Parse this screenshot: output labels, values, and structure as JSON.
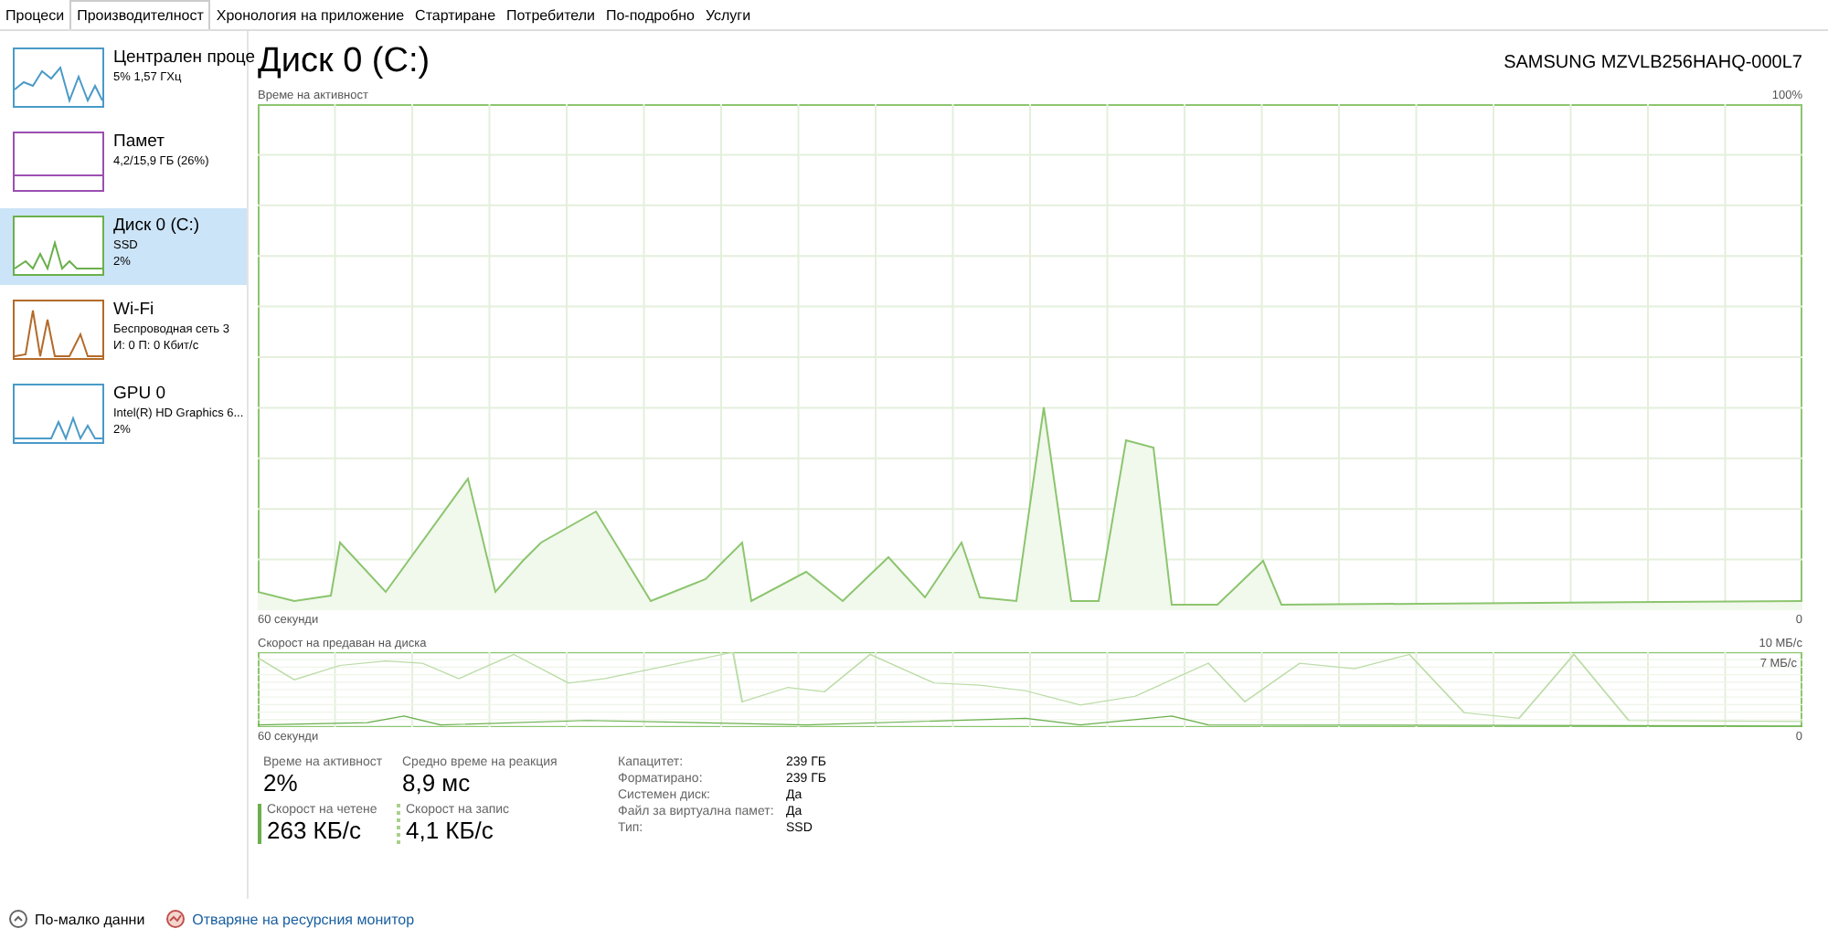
{
  "tabs": [
    {
      "label": "Процеси",
      "selected": false
    },
    {
      "label": "Производителност",
      "selected": true
    },
    {
      "label": "Хронология на приложение",
      "selected": false
    },
    {
      "label": "Стартиране",
      "selected": false
    },
    {
      "label": "Потребители",
      "selected": false
    },
    {
      "label": "По-подробно",
      "selected": false
    },
    {
      "label": "Услуги",
      "selected": false
    }
  ],
  "sidebar": {
    "items": [
      {
        "title": "Централен проце",
        "lines": [
          "5% 1,57 ГХц"
        ],
        "color": "#4a9ac8",
        "selected": false
      },
      {
        "title": "Памет",
        "lines": [
          "4,2/15,9 ГБ (26%)"
        ],
        "color": "#9b4fb0",
        "selected": false
      },
      {
        "title": "Диск 0 (C:)",
        "lines": [
          "SSD",
          "2%"
        ],
        "color": "#6ab04c",
        "selected": true
      },
      {
        "title": "Wi-Fi",
        "lines": [
          "Беспроводная сеть 3",
          "И: 0 П: 0 Кбит/с"
        ],
        "color": "#b36a2a",
        "selected": false
      },
      {
        "title": "GPU 0",
        "lines": [
          "Intel(R) HD Graphics 6...",
          "2%"
        ],
        "color": "#4a9ac8",
        "selected": false
      }
    ]
  },
  "header": {
    "title": "Диск 0 (C:)",
    "model": "SAMSUNG MZVLB256HAHQ-000L7"
  },
  "activity_chart": {
    "label": "Време на активност",
    "max": "100%",
    "time": "60 секунди",
    "min": "0"
  },
  "transfer_chart": {
    "label": "Скорост на предаван на диска",
    "max": "10 МБ/с",
    "mark": "7 МБ/с",
    "time": "60 секунди",
    "min": "0"
  },
  "stats": [
    {
      "label": "Време на активност",
      "value": "2%",
      "kind": "plain"
    },
    {
      "label": "Средно време на реакция",
      "value": "8,9 мс",
      "kind": "plain"
    },
    {
      "label": "Скорост на четене",
      "value": "263 КБ/с",
      "kind": "solid"
    },
    {
      "label": "Скорост на запис",
      "value": "4,1 КБ/с",
      "kind": "dotted"
    }
  ],
  "properties": [
    {
      "name": "Капацитет:",
      "value": "239 ГБ"
    },
    {
      "name": "Форматирано:",
      "value": "239 ГБ"
    },
    {
      "name": "Системен диск:",
      "value": "Да"
    },
    {
      "name": "Файл за виртуална памет:",
      "value": "Да"
    },
    {
      "name": "Тип:",
      "value": "SSD"
    }
  ],
  "footer": {
    "less": "По-малко данни",
    "monitor": "Отваряне на ресурсния монитор"
  }
}
